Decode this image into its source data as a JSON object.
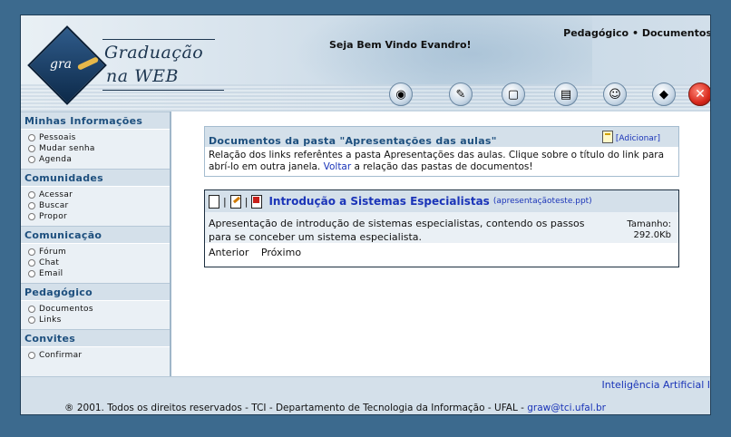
{
  "header": {
    "logo_gra": "gra",
    "logo_line1": "Graduação",
    "logo_line2": "na WEB",
    "welcome": "Seja Bem Vindo Evandro!",
    "nav_pedagogico": "Pedagógico",
    "nav_separator": "•",
    "nav_documentos": "Documentos",
    "toolbar_icons": [
      "globe-user-icon",
      "tools-icon",
      "window-icon",
      "map-icon",
      "person-icon",
      "book-icon",
      "close-icon"
    ]
  },
  "sidebar": {
    "sections": [
      {
        "title": "Minhas Informações",
        "items": [
          "Pessoais",
          "Mudar senha",
          "Agenda"
        ]
      },
      {
        "title": "Comunidades",
        "items": [
          "Acessar",
          "Buscar",
          "Propor"
        ]
      },
      {
        "title": "Comunicação",
        "items": [
          "Fórum",
          "Chat",
          "Email"
        ]
      },
      {
        "title": "Pedagógico",
        "items": [
          "Documentos",
          "Links"
        ]
      },
      {
        "title": "Convites",
        "items": [
          "Confirmar"
        ]
      }
    ]
  },
  "folder": {
    "title": "Documentos da pasta \"Apresentações das aulas\"",
    "add_label": "[Adicionar]",
    "desc_before": "Relação dos links referêntes a pasta Apresentações das aulas. Clique sobre o título do link para abrí-lo em outra janela. ",
    "desc_link": "Voltar",
    "desc_after": " a relação das pastas de documentos!"
  },
  "document": {
    "sep1": "|",
    "sep2": "|",
    "title": "Introdução a Sistemas Especialistas",
    "file": "(apresentaçãoteste.ppt)",
    "description": " Apresentação de introdução de sistemas especialistas, contendo os passos para se conceber um sistema especialista.",
    "size_label": "Tamanho:",
    "size_value": "292.0Kb",
    "prev_label": "Anterior",
    "next_label": "Próximo"
  },
  "footer": {
    "crumb": "Inteligência Artificial I",
    "copyright": "® 2001. Todos os direitos reservados - TCI - Departamento de Tecnologia da Informação - UFAL - ",
    "email": "graw@tci.ufal.br"
  },
  "colors": {
    "background": "#3c6a8e",
    "section_title": "#1d4f7e",
    "link": "#1a34b8",
    "panel": "#d4e0ea"
  }
}
